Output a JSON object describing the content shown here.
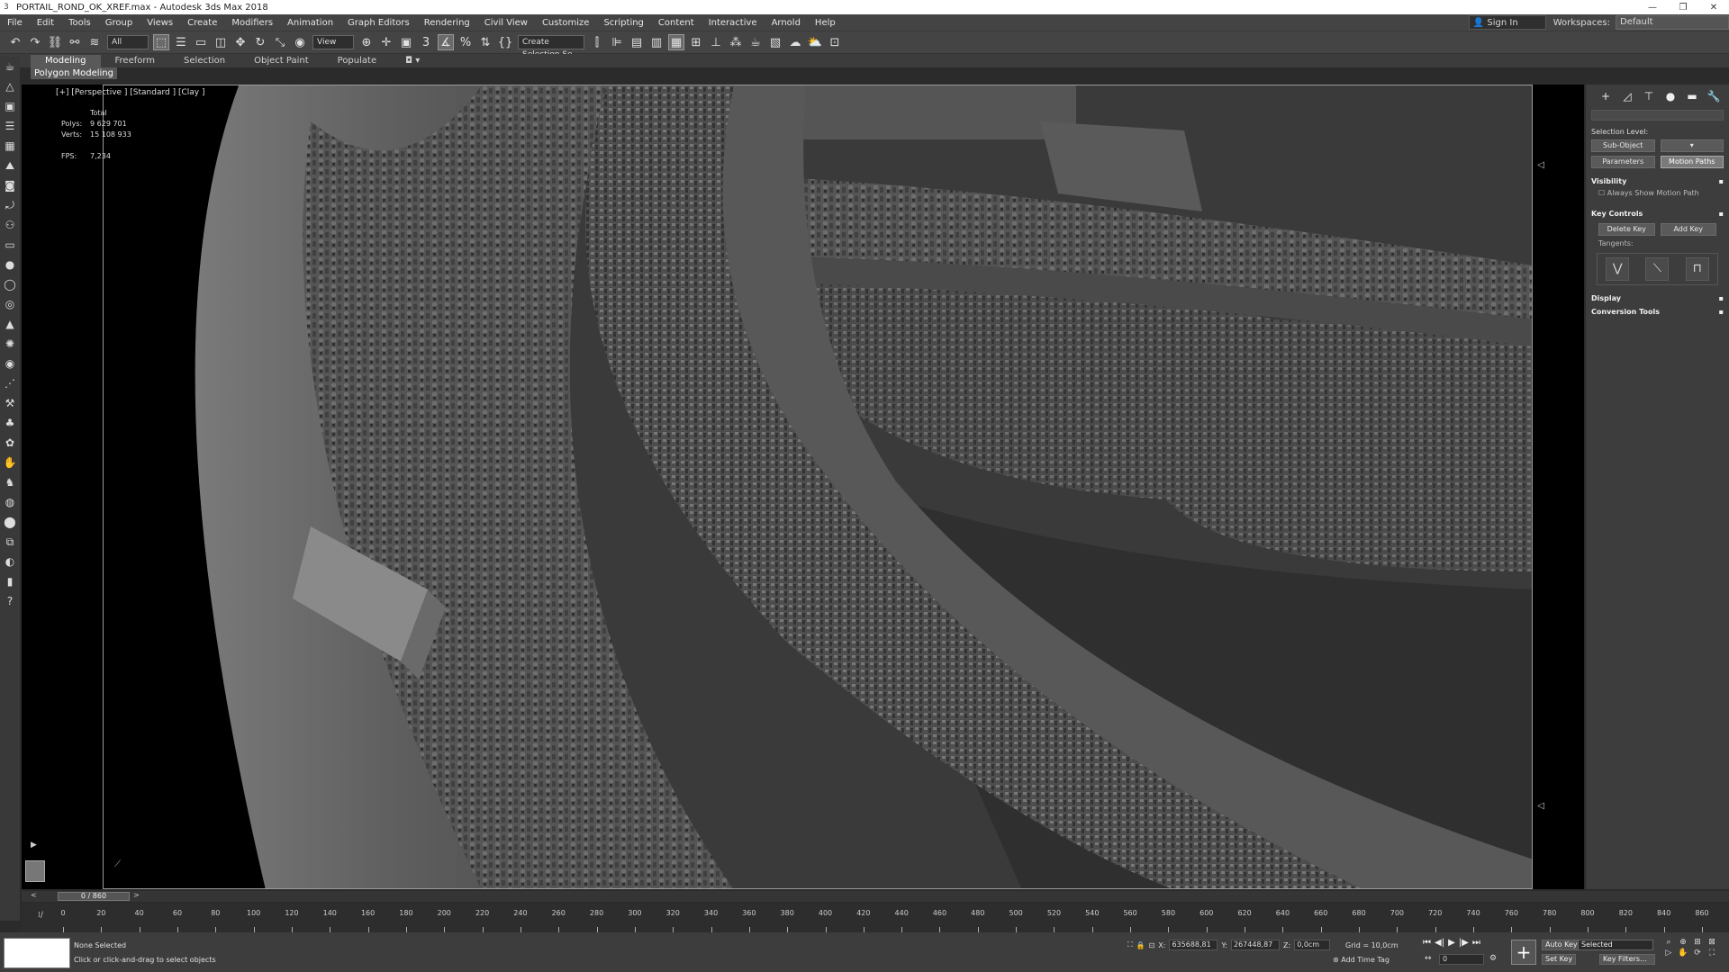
{
  "window": {
    "title": "PORTAIL_ROND_OK_XREF.max - Autodesk 3ds Max 2018",
    "app_icon": "3"
  },
  "menu": [
    "File",
    "Edit",
    "Tools",
    "Group",
    "Views",
    "Create",
    "Modifiers",
    "Animation",
    "Graph Editors",
    "Rendering",
    "Civil View",
    "Customize",
    "Scripting",
    "Content",
    "Interactive",
    "Arnold",
    "Help"
  ],
  "account": {
    "sign_in": "Sign In",
    "workspaces_label": "Workspaces:",
    "workspace_value": "Default"
  },
  "toolbar": {
    "filter_value": "All",
    "ref_coord_value": "View",
    "named_selection_placeholder": "Create Selection Se"
  },
  "ribbon": {
    "tabs": [
      "Modeling",
      "Freeform",
      "Selection",
      "Object Paint",
      "Populate"
    ],
    "sub_panel": "Polygon Modeling"
  },
  "viewport": {
    "label": "[+] [Perspective ] [Standard ] [Clay ]",
    "stats_header": "Total",
    "polys_label": "Polys:",
    "polys_value": "9 629 701",
    "verts_label": "Verts:",
    "verts_value": "15 108 933",
    "fps_label": "FPS:",
    "fps_value": "7,234"
  },
  "command_panel": {
    "selection_level_label": "Selection Level:",
    "sub_object": "Sub-Object",
    "parameters": "Parameters",
    "motion_paths": "Motion Paths",
    "rollouts": {
      "visibility": "Visibility",
      "always_show": "Always Show Motion Path",
      "key_controls": "Key Controls",
      "delete_key": "Delete Key",
      "add_key": "Add Key",
      "tangents": "Tangents:",
      "display": "Display",
      "conversion_tools": "Conversion Tools"
    }
  },
  "time_slider": {
    "value": "0 / 860"
  },
  "track_ticks": [
    0,
    20,
    40,
    60,
    80,
    100,
    120,
    140,
    160,
    180,
    200,
    220,
    240,
    260,
    280,
    300,
    320,
    340,
    360,
    380,
    400,
    420,
    440,
    460,
    480,
    500,
    520,
    540,
    560,
    580,
    600,
    620,
    640,
    660,
    680,
    700,
    720,
    740,
    760,
    780,
    800,
    820,
    840,
    860
  ],
  "track_max": 860,
  "status": {
    "line1": "None Selected",
    "line2": "Click or click-and-drag to select objects",
    "x_label": "X:",
    "x_value": "635688,81",
    "y_label": "Y:",
    "y_value": "267448,87",
    "z_label": "Z:",
    "z_value": "0,0cm",
    "grid": "Grid = 10,0cm",
    "add_time_tag": "Add Time Tag",
    "frame_value": "0",
    "auto_key": "Auto Key",
    "set_key": "Set Key",
    "selected_value": "Selected",
    "key_filters": "Key Filters..."
  },
  "colors": {
    "ui_bg": "#444444",
    "viewport_bg": "#3b3b3b",
    "panel_bg": "#3d3d3d"
  }
}
